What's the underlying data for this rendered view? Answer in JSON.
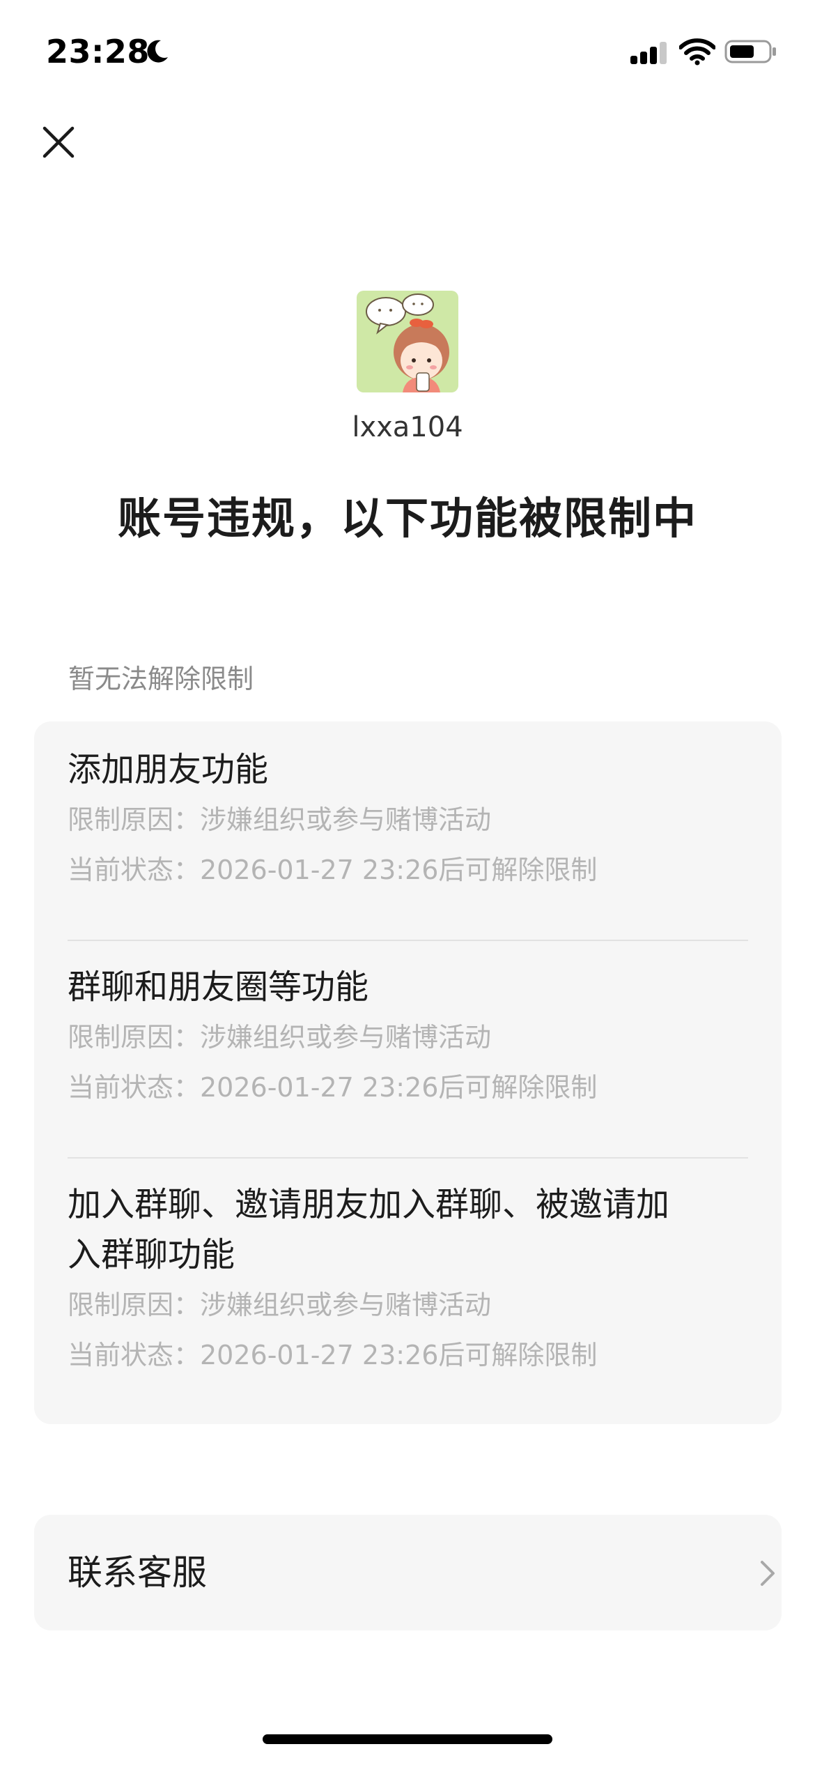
{
  "status_bar": {
    "time": "23:28",
    "moon_icon": "moon-icon",
    "signal_icon": "cellular-signal-icon",
    "wifi_icon": "wifi-icon",
    "battery_icon": "battery-icon"
  },
  "header": {
    "close_icon": "close-icon"
  },
  "profile": {
    "avatar_icon": "cartoon-avatar-icon",
    "username": "lxxa104"
  },
  "page_title": "账号违规，以下功能被限制中",
  "section_label": "暂无法解除限制",
  "restrictions": [
    {
      "title": "添加朋友功能",
      "reason": "限制原因：涉嫌组织或参与赌博活动",
      "status": "当前状态：2026-01-27 23:26后可解除限制"
    },
    {
      "title": "群聊和朋友圈等功能",
      "reason": "限制原因：涉嫌组织或参与赌博活动",
      "status": "当前状态：2026-01-27 23:26后可解除限制"
    },
    {
      "title_line1": "加入群聊、邀请朋友加入群聊、被邀请加",
      "title_line2": "入群聊功能",
      "reason": "限制原因：涉嫌组织或参与赌博活动",
      "status": "当前状态：2026-01-27 23:26后可解除限制"
    }
  ],
  "support": {
    "label": "联系客服",
    "chevron_icon": "chevron-right-icon"
  },
  "colors": {
    "background": "#ffffff",
    "card_background": "#f6f6f6",
    "primary_text": "#1c1c1c",
    "secondary_text": "#b4b4b4",
    "section_label_text": "#8a8a8a",
    "divider": "#e2e2e2"
  }
}
